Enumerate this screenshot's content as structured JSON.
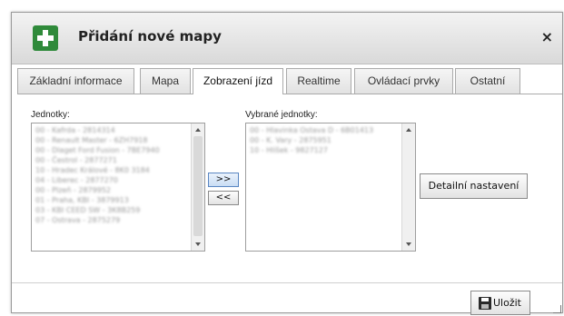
{
  "dialog": {
    "title": "Přidání nové mapy",
    "close_label": "×",
    "accent": "#2f8a3a"
  },
  "tabs": [
    {
      "label": "Základní informace"
    },
    {
      "label": "Mapa"
    },
    {
      "label": "Zobrazení jízd",
      "active": true
    },
    {
      "label": "Realtime"
    },
    {
      "label": "Ovládací prvky"
    },
    {
      "label": "Ostatní"
    }
  ],
  "units": {
    "label": "Jednotky:",
    "items": [
      "00 - Kafrda - 2814314",
      "00 - Renault Master - 6ZH7918",
      "00 - Dlaget Ford Fusion - 7BE7940",
      "00 - Čestrol - 2877271",
      "10 - Hradec Králové - 8K0 3184",
      "04 - Liberec - 2877270",
      "00 - Plzeň - 2879952",
      "01 - Praha, KBI - 3879913",
      "03 - KBI CEED SW - 3K8B259",
      "07 - Ostrava - 2875279"
    ]
  },
  "selected_units": {
    "label": "Vybrané jednotky:",
    "items": [
      "00 - Hlavinka Ostava D - 6B01413",
      "00 - K. Vary - 2875951",
      "10 - Hlíšek - 9827127"
    ]
  },
  "buttons": {
    "add": ">>",
    "remove": "<<",
    "details": "Detailní nastavení",
    "save": "Uložit"
  }
}
